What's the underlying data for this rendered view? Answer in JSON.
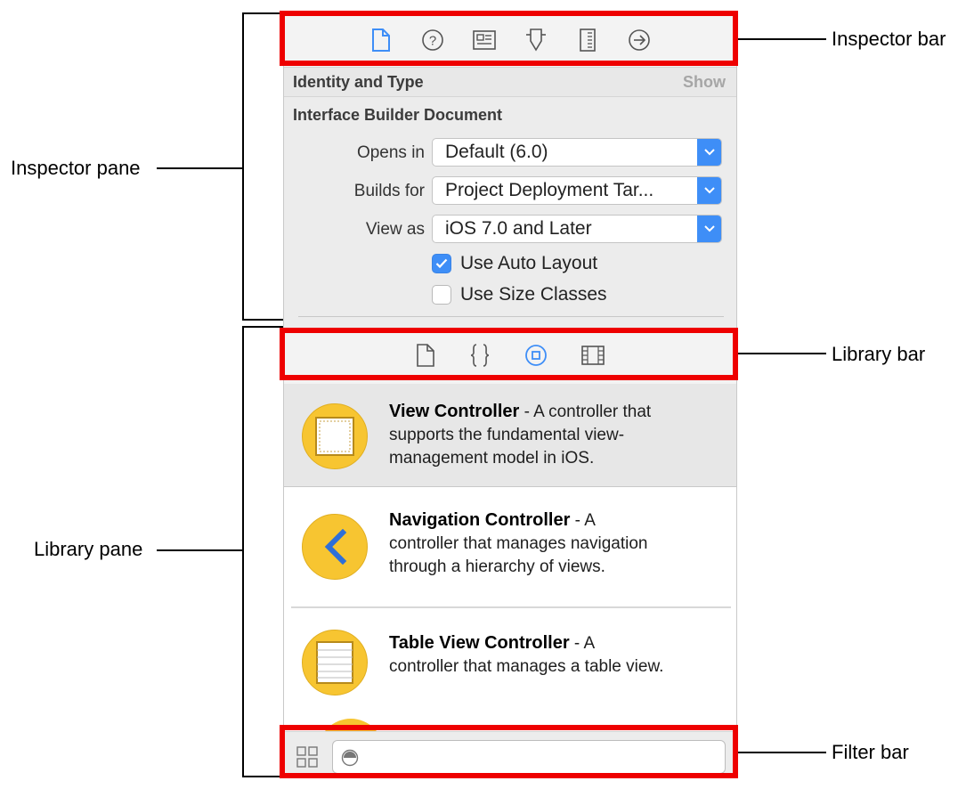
{
  "annotations": {
    "inspector_bar": "Inspector bar",
    "inspector_pane": "Inspector pane",
    "library_bar": "Library bar",
    "library_pane": "Library pane",
    "filter_bar": "Filter bar"
  },
  "inspector_bar": {
    "icons": [
      "file-inspector-icon",
      "quick-help-icon",
      "identity-inspector-icon",
      "attributes-inspector-icon",
      "size-inspector-icon",
      "connections-inspector-icon"
    ],
    "selected": "file-inspector-icon",
    "accent": "#3e8ef7"
  },
  "identity_section": {
    "title": "Identity and Type",
    "show_label": "Show"
  },
  "ib_document": {
    "title": "Interface Builder Document",
    "opens_in": {
      "label": "Opens in",
      "value": "Default (6.0)"
    },
    "builds_for": {
      "label": "Builds for",
      "value": "Project Deployment Tar..."
    },
    "view_as": {
      "label": "View as",
      "value": "iOS 7.0 and Later"
    },
    "use_auto_layout": {
      "label": "Use Auto Layout",
      "checked": true
    },
    "use_size_classes": {
      "label": "Use Size Classes",
      "checked": false
    }
  },
  "library_bar": {
    "icons": [
      "file-template-icon",
      "code-snippet-icon",
      "object-library-icon",
      "media-library-icon"
    ],
    "selected": "object-library-icon"
  },
  "library_items": [
    {
      "name": "View Controller",
      "desc_line1": " - A controller that",
      "desc_line2": "supports the fundamental view-",
      "desc_line3": "management model in iOS.",
      "selected": true
    },
    {
      "name": "Navigation Controller",
      "desc_line1": " - A",
      "desc_line2": "controller that manages navigation",
      "desc_line3": "through a hierarchy of views.",
      "selected": false
    },
    {
      "name": "Table View Controller",
      "desc_line1": " - A",
      "desc_line2": "controller that manages a table view.",
      "selected": false
    }
  ],
  "filter": {
    "placeholder": ""
  },
  "colors": {
    "annotation_red": "#ee0000",
    "icon_yellow": "#f7c531",
    "nav_blue": "#2e6fd8"
  }
}
